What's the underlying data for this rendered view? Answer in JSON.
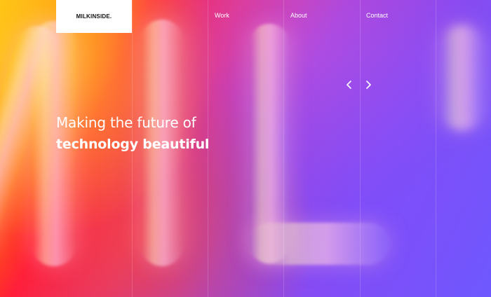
{
  "brand": {
    "logo_text": "MILKINSIDE."
  },
  "nav": {
    "items": [
      {
        "label": "Work"
      },
      {
        "label": "About"
      },
      {
        "label": "Contact"
      }
    ]
  },
  "carousel": {
    "prev_icon": "chevron-left-icon",
    "next_icon": "chevron-right-icon"
  },
  "hero": {
    "line1": "Making the future of",
    "line2": "technology beautiful"
  },
  "colors": {
    "logo_bg": "#ffffff",
    "logo_text": "#111111",
    "text": "#ffffff",
    "gradient": [
      "#ffb800",
      "#ff6a00",
      "#ff1a3c",
      "#e0307a",
      "#a040d8",
      "#8a4af0",
      "#6a5bff"
    ]
  }
}
